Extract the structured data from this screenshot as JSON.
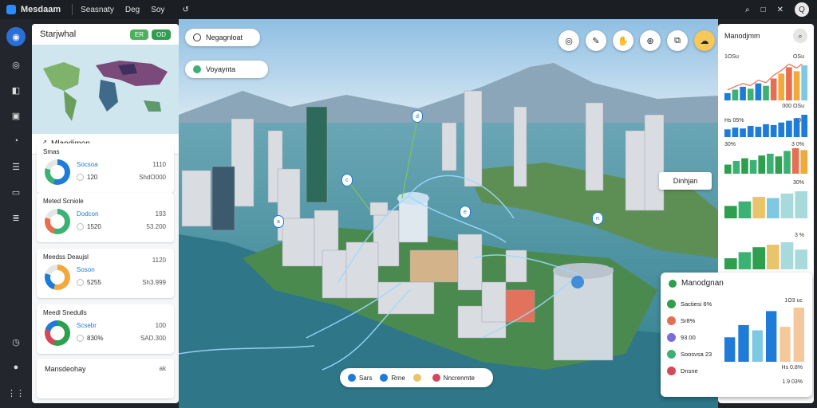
{
  "topbar": {
    "app_name": "Mesdaam",
    "menu": [
      "Seasnaty",
      "Deg",
      "Soy"
    ],
    "menu_icon": "↺",
    "icons": [
      "search-icon",
      "window-icon",
      "close-icon"
    ],
    "avatar_initial": "Q"
  },
  "rail": {
    "items": [
      {
        "icon": "home-icon",
        "glyph": "◉",
        "active": true
      },
      {
        "icon": "compass-icon",
        "glyph": "◎"
      },
      {
        "icon": "layers-icon",
        "glyph": "◧"
      },
      {
        "icon": "calendar-icon",
        "glyph": "▣"
      },
      {
        "icon": "chart-icon",
        "glyph": "◔"
      },
      {
        "icon": "document-icon",
        "glyph": "☰"
      },
      {
        "icon": "chat-icon",
        "glyph": "▭"
      },
      {
        "icon": "list-icon",
        "glyph": "≣"
      }
    ],
    "bottom": [
      {
        "icon": "clock-icon",
        "glyph": "◷"
      },
      {
        "icon": "user-icon",
        "glyph": "●"
      },
      {
        "icon": "grid-icon",
        "glyph": "⋮⋮"
      }
    ]
  },
  "left_panel": {
    "header": "Starjwhal",
    "pills": [
      "ER",
      "OD"
    ],
    "subheader": "Mlandjmon",
    "cards": [
      {
        "title": "Smas",
        "title_right": "",
        "donut": [
          "#1e7bd8",
          "#3bb273",
          "#e5e5e5"
        ],
        "row1": "Socsoa",
        "row1_r": "1110",
        "row2": "120",
        "row2_r": "ShdO000"
      },
      {
        "title": "Meted Scniole",
        "title_right": "",
        "donut": [
          "#3bb273",
          "#e76f51",
          "#e5e5e5"
        ],
        "row1": "Dodcon",
        "row1_r": "193",
        "row2": "1520",
        "row2_r": "53.200"
      },
      {
        "title": "Meedss Deaujsl",
        "title_right": "1120",
        "donut": [
          "#f2a93b",
          "#1e7bd8",
          "#e5e5e5"
        ],
        "row1": "Soson",
        "row1_r": "",
        "row2": "5255",
        "row2_r": "Sh3.999"
      },
      {
        "title": "Meedl Snedulls",
        "title_right": "",
        "donut": [
          "#2e9f4f",
          "#d1495b",
          "#1e7bd8"
        ],
        "row1": "Scsebr",
        "row1_r": "100",
        "row2": "830%",
        "row2_r": "SAD.300"
      }
    ],
    "last_card": {
      "title": "Mansdeohay",
      "right": "ak"
    }
  },
  "map": {
    "chip_top": "Negagnloat",
    "chip_second": "Voyaynta",
    "label_right": "Dinhjan",
    "markers": [
      "d",
      "c",
      "a",
      "e",
      "n"
    ],
    "bottom_chips": [
      {
        "label": "Sars",
        "color": "#1e7bd8"
      },
      {
        "label": "Rrne",
        "color": "#1e7bd8"
      },
      {
        "label": "",
        "color": "#e9c46a"
      },
      {
        "label": "Nncrenmte",
        "color": "#d1495b"
      }
    ],
    "tools": [
      "◎",
      "✎",
      "✋",
      "⊕",
      "⧉",
      "☁"
    ]
  },
  "right_panel": {
    "header": "Manodjmm",
    "header_icon": "search-icon",
    "chart1_labels": [
      "1OSu",
      "OSu"
    ],
    "chart1_bottom": "000 OSu",
    "chart2_labels": [
      "Hs 05%",
      "300"
    ],
    "chart3_labels": [
      "30%",
      "3 0%"
    ],
    "chart4_labels": [
      "30%"
    ],
    "chart5_labels": [
      "3 %"
    ],
    "charts": [
      {
        "values": [
          15,
          22,
          28,
          24,
          35,
          30,
          45,
          55,
          68,
          60,
          72
        ],
        "colors": [
          "#1e7bd8",
          "#3bb273",
          "#1e7bd8",
          "#3bb273",
          "#1e7bd8",
          "#3bb273",
          "#e76f51",
          "#f2a93b",
          "#e76f51",
          "#f2a93b",
          "#7ec8e3"
        ]
      },
      {
        "values": [
          18,
          22,
          20,
          26,
          24,
          30,
          28,
          34,
          38,
          44,
          52
        ],
        "colors": [
          "#1e7bd8",
          "#1e7bd8",
          "#1e7bd8",
          "#1e7bd8",
          "#1e7bd8",
          "#1e7bd8",
          "#1e7bd8",
          "#1e7bd8",
          "#1e7bd8",
          "#1e7bd8",
          "#1e7bd8"
        ]
      },
      {
        "values": [
          20,
          28,
          34,
          30,
          40,
          44,
          38,
          50,
          56,
          52
        ],
        "colors": [
          "#2e9f4f",
          "#3bb273",
          "#2e9f4f",
          "#3bb273",
          "#2e9f4f",
          "#3bb273",
          "#2e9f4f",
          "#3bb273",
          "#e76f51",
          "#f2a93b"
        ]
      },
      {
        "values": [
          22,
          30,
          38,
          36,
          44,
          48
        ],
        "colors": [
          "#2e9f4f",
          "#3bb273",
          "#e9c46a",
          "#7ec8e3",
          "#a8dadc",
          "#a8dadc"
        ]
      },
      {
        "values": [
          18,
          28,
          36,
          40,
          44,
          32
        ],
        "colors": [
          "#2e9f4f",
          "#3bb273",
          "#2e9f4f",
          "#e9c46a",
          "#a8dadc",
          "#a8dadc"
        ]
      }
    ]
  },
  "popup": {
    "title": "Manodgnan",
    "legend": [
      {
        "label": "Sactiesi 6%",
        "color": "#2e9f4f"
      },
      {
        "label": "Sr8%",
        "color": "#e76f51"
      },
      {
        "label": "93.00",
        "color": "#7b6cd9"
      },
      {
        "label": "Soosvsa 23",
        "color": "#3bb273"
      },
      {
        "label": "Dnsne",
        "color": "#d1495b"
      }
    ],
    "right_top": "1O3 uc",
    "right_mid": "Hs 0.8%",
    "right_bot": "1.9 03%",
    "bars": [
      {
        "value": 28,
        "color": "#1e7bd8"
      },
      {
        "value": 42,
        "color": "#1e7bd8"
      },
      {
        "value": 36,
        "color": "#7ec8e3"
      },
      {
        "value": 58,
        "color": "#1e7bd8"
      },
      {
        "value": 40,
        "color": "#f4c89a"
      },
      {
        "value": 62,
        "color": "#f4c89a"
      }
    ]
  }
}
